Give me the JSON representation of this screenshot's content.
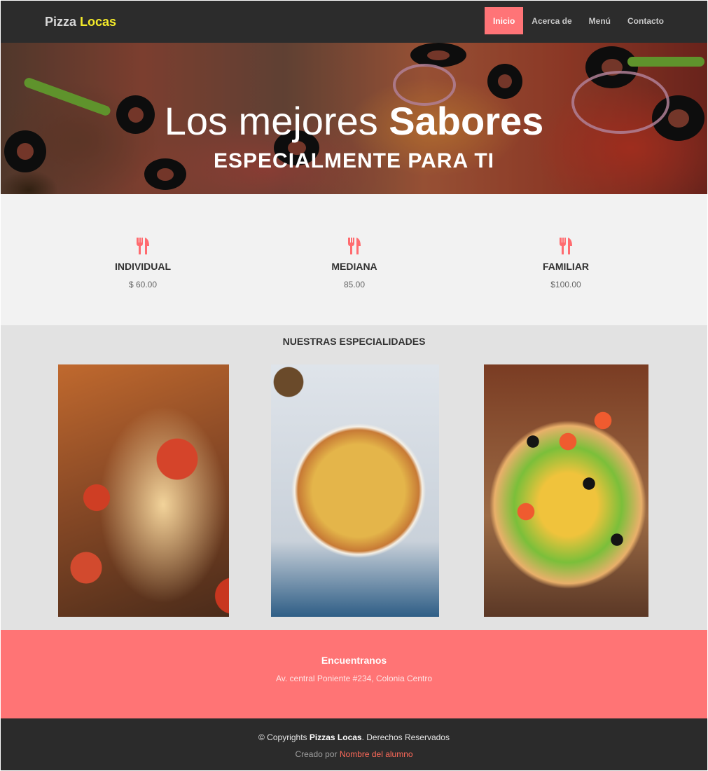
{
  "brand": {
    "part1": "Pizza",
    "part2": "Locas"
  },
  "nav": {
    "items": [
      {
        "label": "Inicio",
        "active": true
      },
      {
        "label": "Acerca de",
        "active": false
      },
      {
        "label": "Menú",
        "active": false
      },
      {
        "label": "Contacto",
        "active": false
      }
    ]
  },
  "hero": {
    "title_light": "Los mejores",
    "title_bold": "Sabores",
    "subtitle": "ESPECIALMENTE PARA TI"
  },
  "features": [
    {
      "icon": "fork-knife-icon",
      "title": "INDIVIDUAL",
      "price": "$ 60.00"
    },
    {
      "icon": "fork-knife-icon",
      "title": "MEDIANA",
      "price": "85.00"
    },
    {
      "icon": "fork-knife-icon",
      "title": "FAMILIAR",
      "price": "$100.00"
    }
  ],
  "specialties": {
    "title": "NUESTRAS ESPECIALIDADES"
  },
  "findus": {
    "title": "Encuentranos",
    "address": "Av. central Poniente #234, Colonia Centro"
  },
  "footer": {
    "copy_prefix": "© Copyrights",
    "copy_brand": "Pizzas Locas",
    "copy_suffix": ". Derechos Reservados",
    "credit_prefix": "Creado por",
    "credit_link": "Nombre del alumno"
  },
  "colors": {
    "accent": "#ff7477",
    "brand_yellow": "#f3ea2a",
    "nav_bg": "#2c2c2c"
  }
}
